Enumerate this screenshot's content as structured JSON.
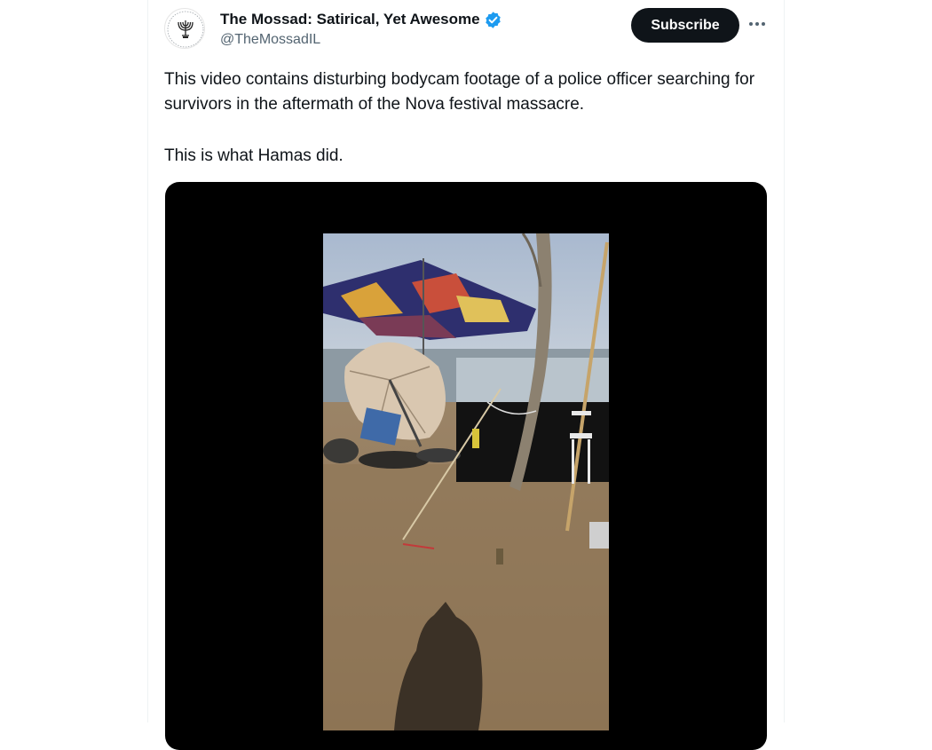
{
  "post": {
    "author": {
      "display_name": "The Mossad: Satirical, Yet Awesome",
      "handle": "@TheMossadIL",
      "verified": true
    },
    "subscribe_label": "Subscribe",
    "text_paragraphs": [
      "This video contains disturbing bodycam footage of a police officer searching for survivors in the aftermath of the Nova festival massacre.",
      "This is what Hamas did."
    ],
    "media": {
      "type": "video"
    }
  },
  "colors": {
    "text_primary": "#0f1419",
    "text_secondary": "#536471",
    "verified_blue": "#1d9bf0",
    "button_bg": "#0f1419",
    "border": "#eff3f4"
  },
  "icons": {
    "verified": "verified-badge-icon",
    "more": "more-horizontal-icon",
    "avatar": "menorah-emblem-icon"
  }
}
